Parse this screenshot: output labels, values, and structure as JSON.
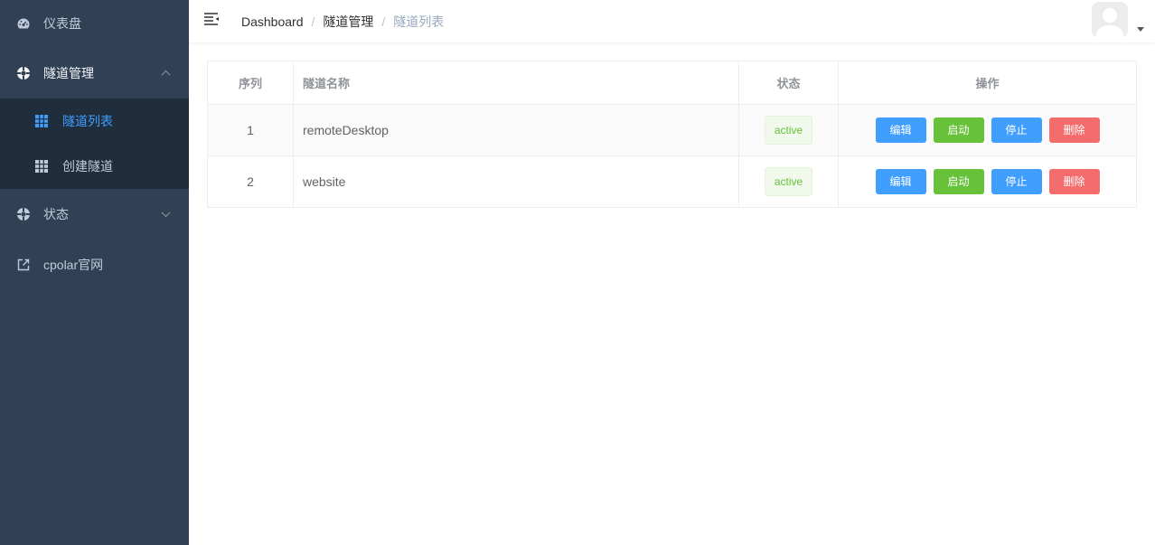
{
  "sidebar": {
    "items": [
      {
        "label": "仪表盘"
      },
      {
        "label": "隧道管理"
      },
      {
        "label": "状态"
      },
      {
        "label": "cpolar官网"
      }
    ],
    "submenu": [
      {
        "label": "隧道列表",
        "active": true
      },
      {
        "label": "创建隧道",
        "active": false
      }
    ]
  },
  "header": {
    "breadcrumb": [
      "Dashboard",
      "隧道管理",
      "隧道列表"
    ],
    "separator": "/"
  },
  "table": {
    "columns": [
      "序列",
      "隧道名称",
      "状态",
      "操作"
    ],
    "rows": [
      {
        "index": "1",
        "name": "remoteDesktop",
        "status": "active"
      },
      {
        "index": "2",
        "name": "website",
        "status": "active"
      }
    ],
    "actions": {
      "edit": "编辑",
      "start": "启动",
      "stop": "停止",
      "delete": "删除"
    }
  },
  "colors": {
    "sidebar_bg": "#304156",
    "submenu_bg": "#1f2d3d",
    "primary": "#409eff",
    "success": "#67c23a",
    "danger": "#f56c6c"
  }
}
